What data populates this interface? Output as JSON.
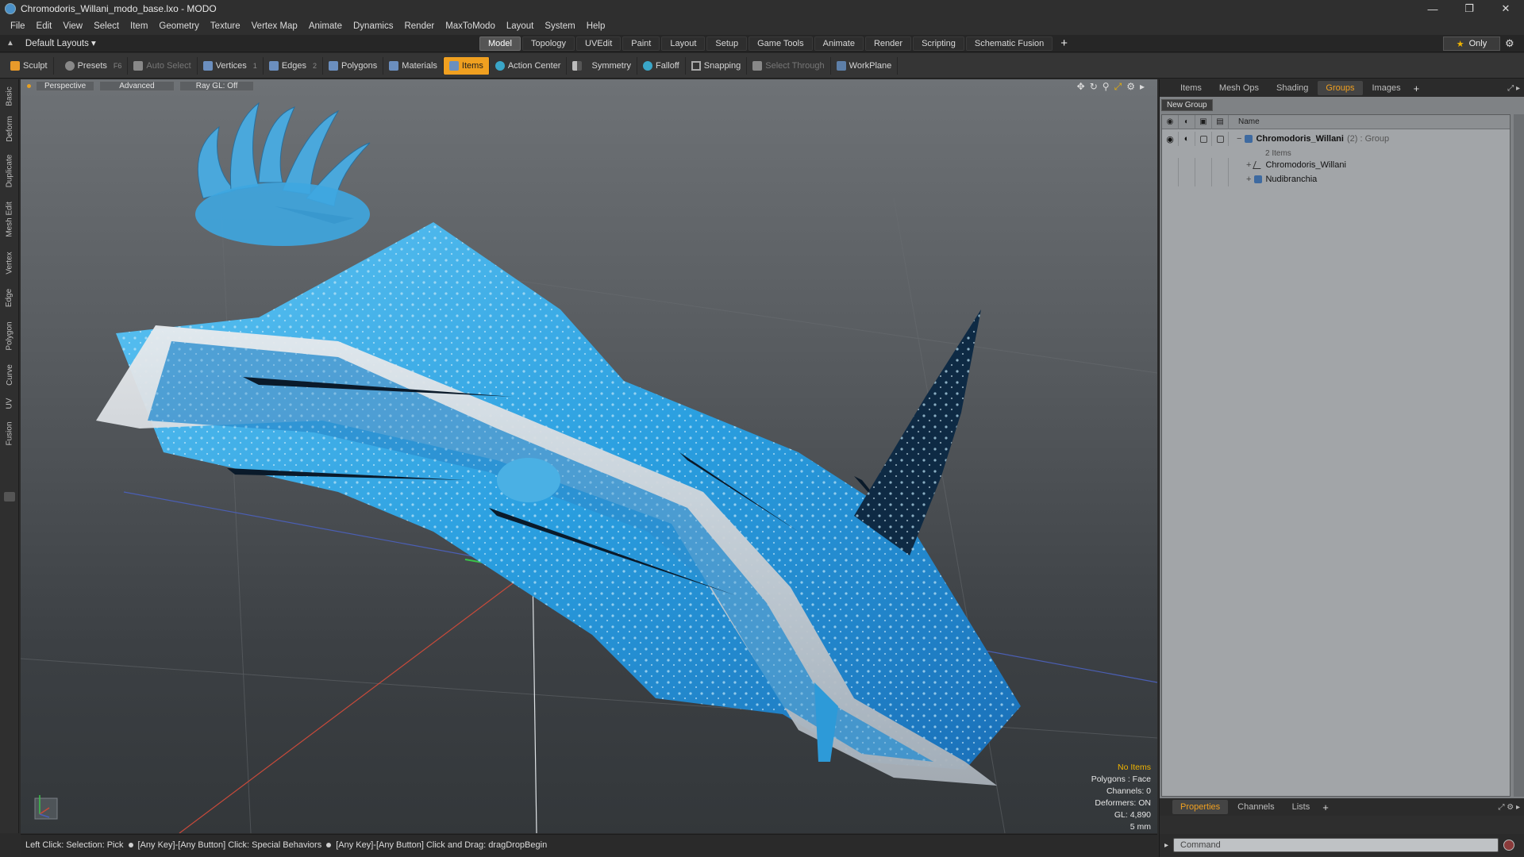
{
  "window": {
    "title": "Chromodoris_Willani_modo_base.lxo - MODO",
    "controls": [
      "minimize",
      "restore",
      "close"
    ]
  },
  "menu": [
    "File",
    "Edit",
    "View",
    "Select",
    "Item",
    "Geometry",
    "Texture",
    "Vertex Map",
    "Animate",
    "Dynamics",
    "Render",
    "MaxToModo",
    "Layout",
    "System",
    "Help"
  ],
  "layout_select": "Default Layouts ▾",
  "tabs": {
    "items": [
      "Model",
      "Topology",
      "UVEdit",
      "Paint",
      "Layout",
      "Setup",
      "Game Tools",
      "Animate",
      "Render",
      "Scripting",
      "Schematic Fusion"
    ],
    "active": "Model",
    "only_label": "Only"
  },
  "toolbar": {
    "sculpt": "Sculpt",
    "presets": "Presets",
    "presets_key": "F6",
    "auto_select": "Auto Select",
    "vertices": "Vertices",
    "vertices_key": "1",
    "edges": "Edges",
    "edges_key": "2",
    "polygons": "Polygons",
    "materials": "Materials",
    "items": "Items",
    "action_center": "Action Center",
    "symmetry": "Symmetry",
    "falloff": "Falloff",
    "snapping": "Snapping",
    "select_through": "Select Through",
    "workplane": "WorkPlane"
  },
  "left_tabs": [
    "Basic",
    "Deform",
    "Duplicate",
    "Mesh Edit",
    "Vertex",
    "Edge",
    "Polygon",
    "Curve",
    "UV",
    "Fusion"
  ],
  "viewport": {
    "view_mode": "Perspective",
    "shading": "Advanced",
    "raygl": "Ray GL: Off",
    "info": {
      "selection": "No Items",
      "polygons": "Polygons : Face",
      "channels": "Channels: 0",
      "deformers": "Deformers: ON",
      "gl": "GL: 4,890",
      "grid": "5 mm"
    }
  },
  "status": {
    "part1": "Left Click: Selection: Pick",
    "part2": "[Any Key]-[Any Button] Click: Special Behaviors",
    "part3": "[Any Key]-[Any Button] Click and Drag: dragDropBegin"
  },
  "right_panel": {
    "tabs": [
      "Items",
      "Mesh Ops",
      "Shading",
      "Groups",
      "Images"
    ],
    "active_tab": "Groups",
    "new_group": "New Group",
    "column_name": "Name",
    "tree": {
      "group_name": "Chromodoris_Willani",
      "group_meta": "(2) : Group",
      "group_count": "2 Items",
      "children": [
        "Chromodoris_Willani",
        "Nudibranchia"
      ]
    },
    "bottom_tabs": [
      "Properties",
      "Channels",
      "Lists"
    ],
    "bottom_active": "Properties",
    "command_placeholder": "Command"
  },
  "colors": {
    "accent": "#f0a020",
    "creature_blue": "#2ea0e0"
  }
}
